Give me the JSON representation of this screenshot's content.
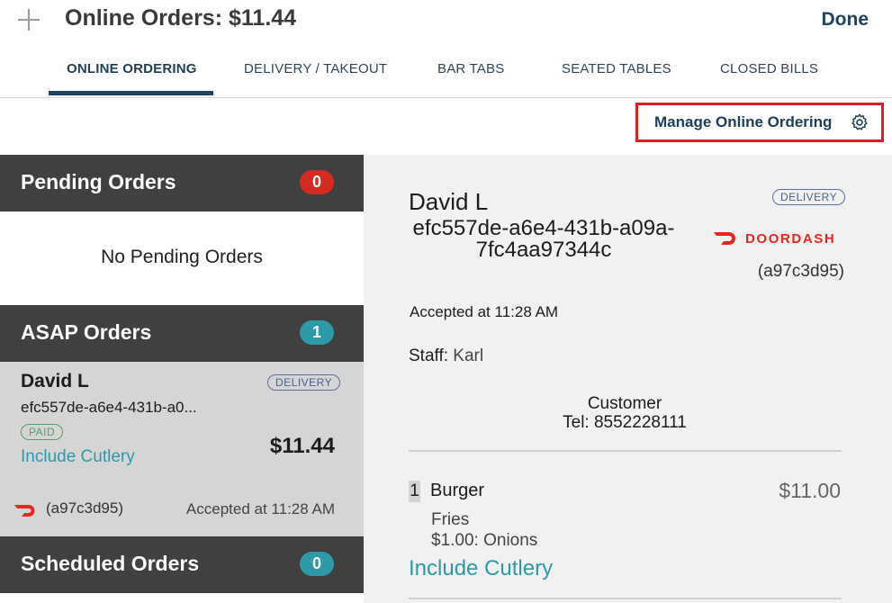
{
  "header": {
    "title": "Online Orders: $11.44",
    "done_label": "Done"
  },
  "tabs": [
    {
      "label": "ONLINE ORDERING",
      "active": true
    },
    {
      "label": "DELIVERY / TAKEOUT",
      "active": false
    },
    {
      "label": "BAR TABS",
      "active": false
    },
    {
      "label": "SEATED TABLES",
      "active": false
    },
    {
      "label": "CLOSED BILLS",
      "active": false
    }
  ],
  "manage": {
    "label": "Manage Online Ordering",
    "icon": "gear-icon",
    "highlight_color": "#d9212a"
  },
  "left": {
    "pending": {
      "title": "Pending Orders",
      "count": "0",
      "badge_color": "#d42a22"
    },
    "no_pending_text": "No Pending Orders",
    "asap": {
      "title": "ASAP Orders",
      "count": "1",
      "badge_color": "#2e9aa8"
    },
    "order": {
      "name": "David L",
      "id_truncated": "efc557de-a6e4-431b-a0...",
      "type_badge": "DELIVERY",
      "status_badge": "PAID",
      "note": "Include Cutlery",
      "price": "$11.44",
      "provider_icon": "doordash-icon",
      "code": "(a97c3d95)",
      "accepted": "Accepted at 11:28 AM"
    },
    "scheduled": {
      "title": "Scheduled Orders",
      "count": "0",
      "badge_color": "#2e9aa8"
    }
  },
  "detail": {
    "name": "David L",
    "order_id": "efc557de-a6e4-431b-a09a-7fc4aa97344c",
    "type_badge": "DELIVERY",
    "provider": "DOORDASH",
    "provider_color": "#e8261f",
    "code": "(a97c3d95)",
    "accepted": "Accepted at 11:28 AM",
    "staff_label": "Staff:",
    "staff_name": "Karl",
    "customer_label": "Customer",
    "customer_tel": "Tel: 8552228111",
    "items": [
      {
        "qty": "1",
        "name": "Burger",
        "price": "$11.00",
        "modifiers": [
          "Fries",
          "$1.00: Onions"
        ]
      }
    ],
    "note": "Include Cutlery"
  }
}
